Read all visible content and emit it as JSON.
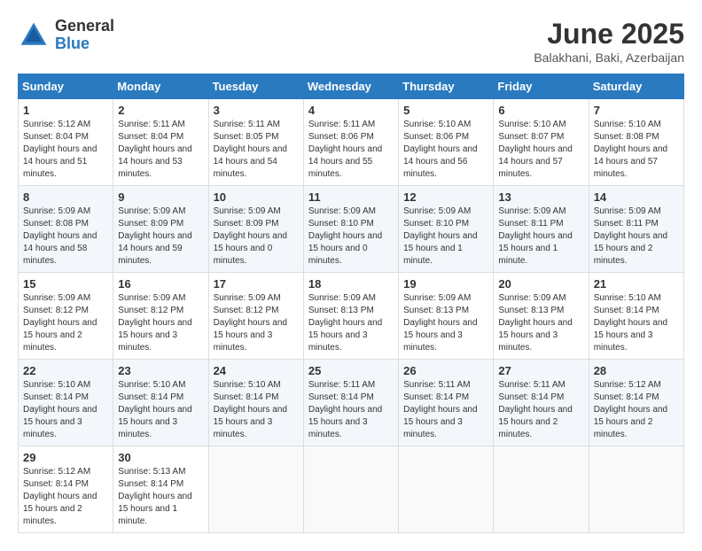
{
  "logo": {
    "general": "General",
    "blue": "Blue"
  },
  "title": "June 2025",
  "subtitle": "Balakhani, Baki, Azerbaijan",
  "weekdays": [
    "Sunday",
    "Monday",
    "Tuesday",
    "Wednesday",
    "Thursday",
    "Friday",
    "Saturday"
  ],
  "weeks": [
    [
      {
        "day": "1",
        "sunrise": "5:12 AM",
        "sunset": "8:04 PM",
        "daylight": "14 hours and 51 minutes."
      },
      {
        "day": "2",
        "sunrise": "5:11 AM",
        "sunset": "8:04 PM",
        "daylight": "14 hours and 53 minutes."
      },
      {
        "day": "3",
        "sunrise": "5:11 AM",
        "sunset": "8:05 PM",
        "daylight": "14 hours and 54 minutes."
      },
      {
        "day": "4",
        "sunrise": "5:11 AM",
        "sunset": "8:06 PM",
        "daylight": "14 hours and 55 minutes."
      },
      {
        "day": "5",
        "sunrise": "5:10 AM",
        "sunset": "8:06 PM",
        "daylight": "14 hours and 56 minutes."
      },
      {
        "day": "6",
        "sunrise": "5:10 AM",
        "sunset": "8:07 PM",
        "daylight": "14 hours and 57 minutes."
      },
      {
        "day": "7",
        "sunrise": "5:10 AM",
        "sunset": "8:08 PM",
        "daylight": "14 hours and 57 minutes."
      }
    ],
    [
      {
        "day": "8",
        "sunrise": "5:09 AM",
        "sunset": "8:08 PM",
        "daylight": "14 hours and 58 minutes."
      },
      {
        "day": "9",
        "sunrise": "5:09 AM",
        "sunset": "8:09 PM",
        "daylight": "14 hours and 59 minutes."
      },
      {
        "day": "10",
        "sunrise": "5:09 AM",
        "sunset": "8:09 PM",
        "daylight": "15 hours and 0 minutes."
      },
      {
        "day": "11",
        "sunrise": "5:09 AM",
        "sunset": "8:10 PM",
        "daylight": "15 hours and 0 minutes."
      },
      {
        "day": "12",
        "sunrise": "5:09 AM",
        "sunset": "8:10 PM",
        "daylight": "15 hours and 1 minute."
      },
      {
        "day": "13",
        "sunrise": "5:09 AM",
        "sunset": "8:11 PM",
        "daylight": "15 hours and 1 minute."
      },
      {
        "day": "14",
        "sunrise": "5:09 AM",
        "sunset": "8:11 PM",
        "daylight": "15 hours and 2 minutes."
      }
    ],
    [
      {
        "day": "15",
        "sunrise": "5:09 AM",
        "sunset": "8:12 PM",
        "daylight": "15 hours and 2 minutes."
      },
      {
        "day": "16",
        "sunrise": "5:09 AM",
        "sunset": "8:12 PM",
        "daylight": "15 hours and 3 minutes."
      },
      {
        "day": "17",
        "sunrise": "5:09 AM",
        "sunset": "8:12 PM",
        "daylight": "15 hours and 3 minutes."
      },
      {
        "day": "18",
        "sunrise": "5:09 AM",
        "sunset": "8:13 PM",
        "daylight": "15 hours and 3 minutes."
      },
      {
        "day": "19",
        "sunrise": "5:09 AM",
        "sunset": "8:13 PM",
        "daylight": "15 hours and 3 minutes."
      },
      {
        "day": "20",
        "sunrise": "5:09 AM",
        "sunset": "8:13 PM",
        "daylight": "15 hours and 3 minutes."
      },
      {
        "day": "21",
        "sunrise": "5:10 AM",
        "sunset": "8:14 PM",
        "daylight": "15 hours and 3 minutes."
      }
    ],
    [
      {
        "day": "22",
        "sunrise": "5:10 AM",
        "sunset": "8:14 PM",
        "daylight": "15 hours and 3 minutes."
      },
      {
        "day": "23",
        "sunrise": "5:10 AM",
        "sunset": "8:14 PM",
        "daylight": "15 hours and 3 minutes."
      },
      {
        "day": "24",
        "sunrise": "5:10 AM",
        "sunset": "8:14 PM",
        "daylight": "15 hours and 3 minutes."
      },
      {
        "day": "25",
        "sunrise": "5:11 AM",
        "sunset": "8:14 PM",
        "daylight": "15 hours and 3 minutes."
      },
      {
        "day": "26",
        "sunrise": "5:11 AM",
        "sunset": "8:14 PM",
        "daylight": "15 hours and 3 minutes."
      },
      {
        "day": "27",
        "sunrise": "5:11 AM",
        "sunset": "8:14 PM",
        "daylight": "15 hours and 2 minutes."
      },
      {
        "day": "28",
        "sunrise": "5:12 AM",
        "sunset": "8:14 PM",
        "daylight": "15 hours and 2 minutes."
      }
    ],
    [
      {
        "day": "29",
        "sunrise": "5:12 AM",
        "sunset": "8:14 PM",
        "daylight": "15 hours and 2 minutes."
      },
      {
        "day": "30",
        "sunrise": "5:13 AM",
        "sunset": "8:14 PM",
        "daylight": "15 hours and 1 minute."
      },
      null,
      null,
      null,
      null,
      null
    ]
  ]
}
